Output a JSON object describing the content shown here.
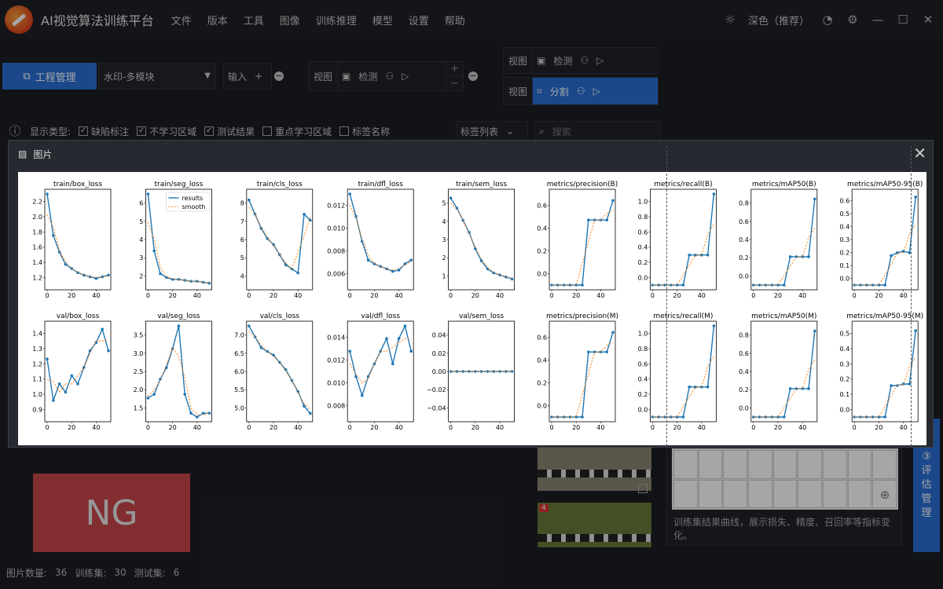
{
  "app": {
    "title": "AI视觉算法训练平台",
    "menu": [
      "文件",
      "版本",
      "工具",
      "图像",
      "训练推理",
      "模型",
      "设置",
      "帮助"
    ],
    "theme": "深色（推荐）"
  },
  "toolbar": {
    "project_btn": "工程管理",
    "project_select": "水印-多模块",
    "input_label": "输入",
    "view_label": "视图",
    "detect_label": "检测",
    "segment_label": "分割",
    "plus": "+",
    "minus": "−"
  },
  "filters": {
    "label": "显示类型:",
    "items": [
      {
        "label": "缺陷标注",
        "checked": true
      },
      {
        "label": "不学习区域",
        "checked": true
      },
      {
        "label": "测试结果",
        "checked": true
      },
      {
        "label": "重点学习区域",
        "checked": false
      },
      {
        "label": "标签名称",
        "checked": false
      }
    ],
    "tag_list": "标签列表",
    "search_placeholder": "搜索"
  },
  "dialog": {
    "title": "图片"
  },
  "left": {
    "ng": "NG"
  },
  "thumbs": {
    "badge": "4"
  },
  "right_panel": {
    "desc": "训练集结果曲线，展示损失、精度、召回率等指标变化。"
  },
  "eval_btn": {
    "num": "③",
    "l1": "评",
    "l2": "估",
    "l3": "管",
    "l4": "理"
  },
  "status": {
    "count_label": "图片数量:",
    "count": "36",
    "train_label": "训练集:",
    "train": "30",
    "test_label": "测试集:",
    "test": "6"
  },
  "colors": {
    "accent": "#2a6fd6",
    "ng": "#c8454a",
    "results": "#1f77b4",
    "smooth": "#ff7f0e"
  },
  "chart_data": {
    "type": "line",
    "legend": [
      "results",
      "smooth"
    ],
    "x": [
      0,
      10,
      20,
      30,
      40,
      50
    ],
    "panels": [
      {
        "title": "train/box_loss",
        "ylim": [
          1.1,
          2.2
        ],
        "yticks": [
          "1.2",
          "1.4",
          "1.6",
          "1.8",
          "2.0",
          "2.2"
        ],
        "values": [
          2.2,
          1.7,
          1.5,
          1.35,
          1.3,
          1.25,
          1.22,
          1.2,
          1.18,
          1.2,
          1.22
        ]
      },
      {
        "title": "train/seg_loss",
        "ylim": [
          1.2,
          6.0
        ],
        "yticks": [
          "2",
          "3",
          "4",
          "5",
          "6"
        ],
        "values": [
          6.0,
          3.0,
          1.8,
          1.6,
          1.5,
          1.5,
          1.45,
          1.4,
          1.4,
          1.35,
          1.3
        ]
      },
      {
        "title": "train/cls_loss",
        "ylim": [
          4.0,
          8.5
        ],
        "yticks": [
          "4",
          "5",
          "6",
          "7",
          "8"
        ],
        "values": [
          8.2,
          7.5,
          6.8,
          6.3,
          6.0,
          5.5,
          5.0,
          4.8,
          4.6,
          7.5,
          7.2
        ]
      },
      {
        "title": "train/dfl_loss",
        "ylim": [
          0.0055,
          0.0128
        ],
        "yticks": [
          "0.006",
          "0.008",
          "0.010",
          "0.012"
        ],
        "values": [
          0.0128,
          0.011,
          0.009,
          0.0075,
          0.0072,
          0.007,
          0.0068,
          0.0066,
          0.0067,
          0.0072,
          0.0075
        ]
      },
      {
        "title": "train/sem_loss",
        "ylim": [
          1.0,
          5.5
        ],
        "yticks": [
          "1",
          "2",
          "3",
          "4",
          "5"
        ],
        "values": [
          5.3,
          4.8,
          4.2,
          3.6,
          2.8,
          2.2,
          1.8,
          1.6,
          1.5,
          1.4,
          1.3
        ]
      },
      {
        "title": "metrics/precision(B)",
        "ylim": [
          0.0,
          0.7
        ],
        "yticks": [
          "0.0",
          "0.2",
          "0.4",
          "0.6"
        ],
        "values": [
          0,
          0,
          0,
          0,
          0,
          0,
          0.5,
          0.5,
          0.5,
          0.5,
          0.65
        ]
      },
      {
        "title": "metrics/recall(B)",
        "ylim": [
          0.0,
          1.0
        ],
        "yticks": [
          "0.0",
          "0.2",
          "0.4",
          "0.6",
          "0.8",
          "1.0"
        ],
        "values": [
          0,
          0,
          0,
          0,
          0,
          0,
          0.33,
          0.33,
          0.33,
          0.33,
          1.0
        ]
      },
      {
        "title": "metrics/mAP50(B)",
        "ylim": [
          0.0,
          0.9
        ],
        "yticks": [
          "0.0",
          "0.2",
          "0.4",
          "0.6",
          "0.8"
        ],
        "values": [
          0,
          0,
          0,
          0,
          0,
          0,
          0.28,
          0.28,
          0.28,
          0.28,
          0.85
        ]
      },
      {
        "title": "metrics/mAP50-95(B)",
        "ylim": [
          0.0,
          0.62
        ],
        "yticks": [
          "0.0",
          "0.1",
          "0.2",
          "0.3",
          "0.4",
          "0.5",
          "0.6"
        ],
        "values": [
          0,
          0,
          0,
          0,
          0,
          0,
          0.2,
          0.22,
          0.23,
          0.22,
          0.6
        ]
      },
      {
        "title": "val/box_loss",
        "ylim": [
          0.85,
          1.4
        ],
        "yticks": [
          "0.9",
          "1.0",
          "1.1",
          "1.2",
          "1.3",
          "1.4"
        ],
        "values": [
          1.2,
          0.95,
          1.05,
          1.0,
          1.1,
          1.05,
          1.15,
          1.25,
          1.3,
          1.38,
          1.25
        ]
      },
      {
        "title": "val/seg_loss",
        "ylim": [
          1.2,
          3.6
        ],
        "yticks": [
          "1.5",
          "2.0",
          "2.5",
          "3.0",
          "3.5"
        ],
        "values": [
          1.7,
          1.8,
          2.2,
          2.5,
          3.0,
          3.6,
          1.8,
          1.3,
          1.2,
          1.3,
          1.3
        ]
      },
      {
        "title": "val/cls_loss",
        "ylim": [
          4.7,
          7.2
        ],
        "yticks": [
          "5.0",
          "5.5",
          "6.0",
          "6.5",
          "7.0"
        ],
        "values": [
          7.2,
          6.9,
          6.6,
          6.5,
          6.4,
          6.2,
          6.0,
          5.7,
          5.4,
          5.0,
          4.8
        ]
      },
      {
        "title": "val/dfl_loss",
        "ylim": [
          0.0078,
          0.015
        ],
        "yticks": [
          "0.008",
          "0.010",
          "0.012",
          "0.014"
        ],
        "values": [
          0.013,
          0.011,
          0.0095,
          0.011,
          0.012,
          0.013,
          0.014,
          0.012,
          0.014,
          0.015,
          0.013
        ]
      },
      {
        "title": "val/sem_loss",
        "ylim": [
          -0.05,
          0.05
        ],
        "yticks": [
          "−0.04",
          "−0.02",
          "0.00",
          "0.02",
          "0.04"
        ],
        "values": [
          0,
          0,
          0,
          0,
          0,
          0,
          0,
          0,
          0,
          0,
          0
        ]
      },
      {
        "title": "metrics/precision(M)",
        "ylim": [
          0.0,
          0.7
        ],
        "yticks": [
          "0.0",
          "0.2",
          "0.4",
          "0.6"
        ],
        "values": [
          0,
          0,
          0,
          0,
          0,
          0,
          0.5,
          0.5,
          0.5,
          0.5,
          0.65
        ]
      },
      {
        "title": "metrics/recall(M)",
        "ylim": [
          0.0,
          1.0
        ],
        "yticks": [
          "0.0",
          "0.2",
          "0.4",
          "0.6",
          "0.8",
          "1.0"
        ],
        "values": [
          0,
          0,
          0,
          0,
          0,
          0,
          0.33,
          0.33,
          0.33,
          0.33,
          1.0
        ]
      },
      {
        "title": "metrics/mAP50(M)",
        "ylim": [
          0.0,
          0.9
        ],
        "yticks": [
          "0.0",
          "0.2",
          "0.4",
          "0.6",
          "0.8"
        ],
        "values": [
          0,
          0,
          0,
          0,
          0,
          0,
          0.28,
          0.28,
          0.28,
          0.28,
          0.85
        ]
      },
      {
        "title": "metrics/mAP50-95(M)",
        "ylim": [
          0.0,
          0.58
        ],
        "yticks": [
          "0.0",
          "0.1",
          "0.2",
          "0.3",
          "0.4",
          "0.5"
        ],
        "values": [
          0,
          0,
          0,
          0,
          0,
          0,
          0.2,
          0.2,
          0.21,
          0.21,
          0.55
        ]
      }
    ]
  }
}
